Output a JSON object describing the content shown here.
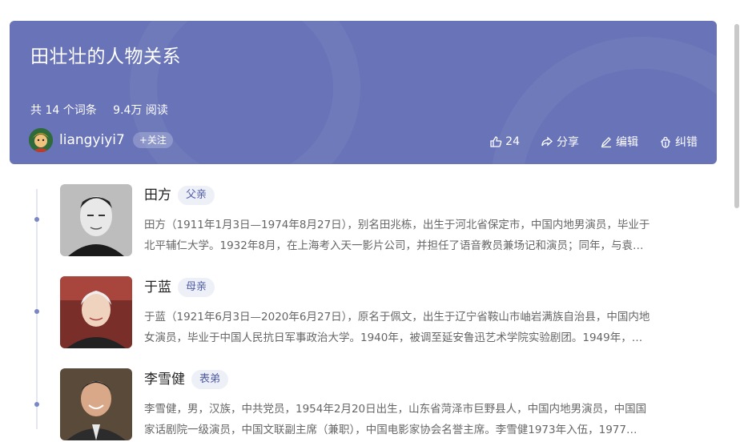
{
  "header": {
    "title": "田壮壮的人物关系",
    "entry_count": "共 14 个词条",
    "views": "9.4万 阅读",
    "author": "liangyiyi7",
    "follow_label": "+关注",
    "like_count": "24",
    "share_label": "分享",
    "edit_label": "编辑",
    "report_label": "纠错"
  },
  "people": [
    {
      "name": "田方",
      "relation": "父亲",
      "line1": "田方（1911年1月3日—1974年8月27日），别名田兆栋，出生于河北省保定市，中国内地男演员，毕业于",
      "line2": "北平辅仁大学。1932年8月，在上海考入天一影片公司，并担任了语音教员兼场记和演员；同年，与袁…"
    },
    {
      "name": "于蓝",
      "relation": "母亲",
      "line1": "于蓝（1921年6月3日—2020年6月27日），原名于佩文，出生于辽宁省鞍山市岫岩满族自治县，中国内地",
      "line2": "女演员，毕业于中国人民抗日军事政治大学。1940年，被调至延安鲁迅艺术学院实验剧团。1949年，…"
    },
    {
      "name": "李雪健",
      "relation": "表弟",
      "line1": "李雪健，男，汉族，中共党员，1954年2月20日出生，山东省菏泽市巨野县人，中国内地男演员，中国国",
      "line2": "家话剧院一级演员，中国文联副主席（兼职），中国电影家协会名誉主席。李雪健1973年入伍，1977…"
    }
  ],
  "colors": {
    "banner": "#6873b8",
    "accent": "#4e5aa6"
  }
}
